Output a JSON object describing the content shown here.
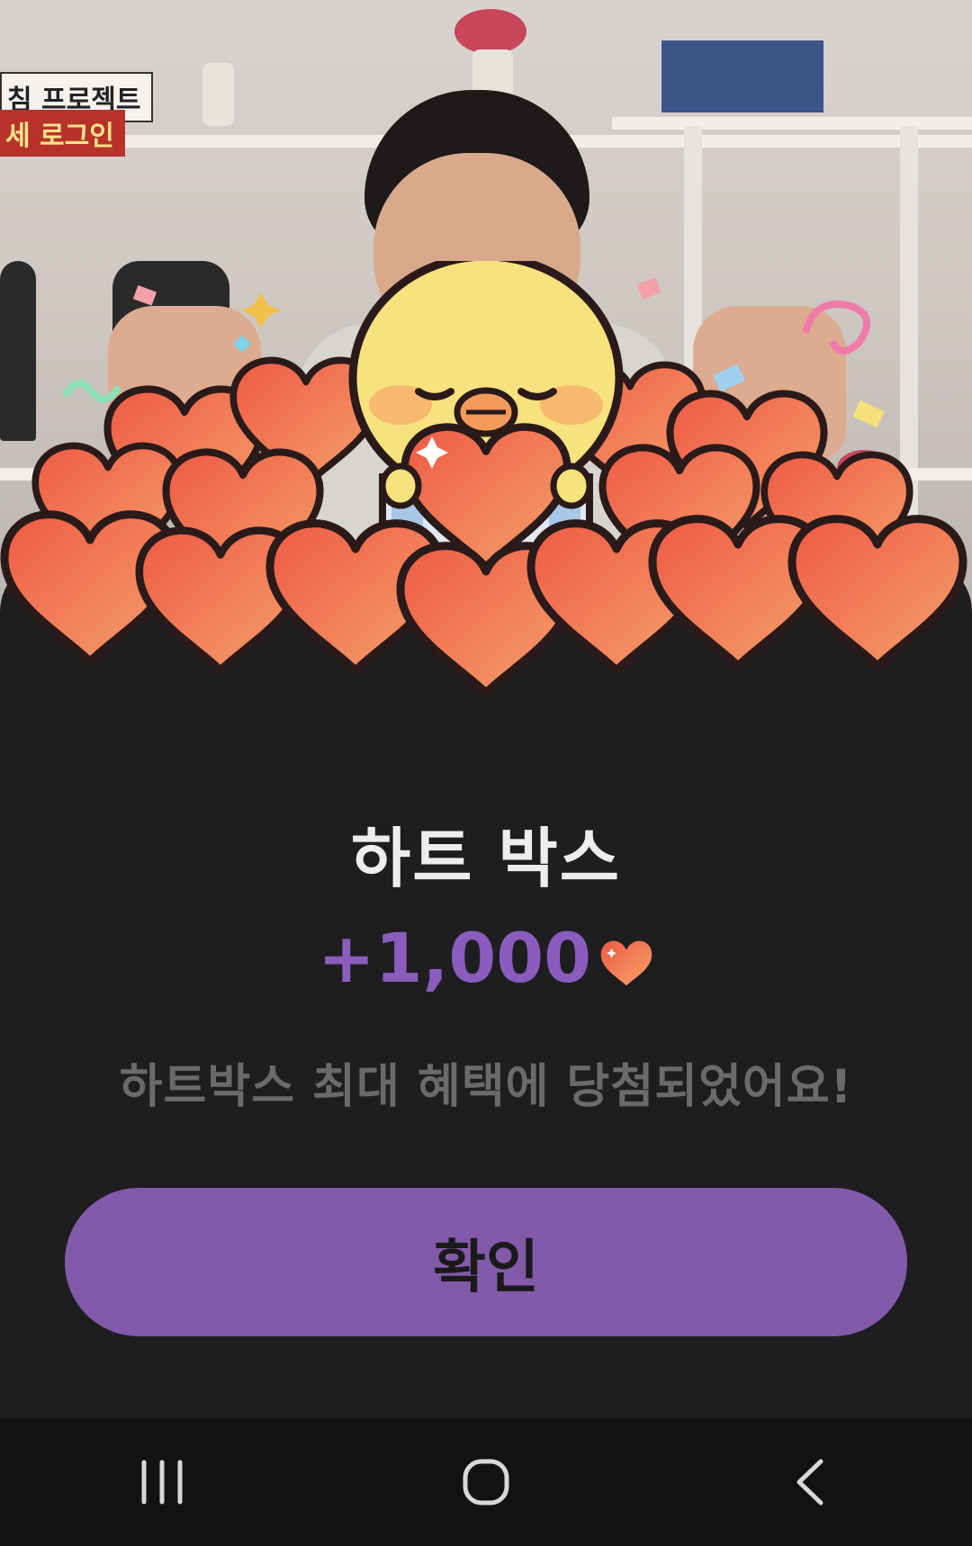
{
  "video": {
    "caption_top": "침 프로젝트",
    "caption_bottom": "세 로그인"
  },
  "dialog": {
    "title": "하트 박스",
    "reward_amount": "+1,000",
    "reward_icon": "heart-icon",
    "message": "하트박스 최대 혜택에 당첨되었어요!",
    "confirm_label": "확인"
  },
  "navbar": {
    "recent_icon": "recent-apps-icon",
    "home_icon": "home-icon",
    "back_icon": "back-icon"
  },
  "colors": {
    "accent": "#8359aa",
    "reward_text": "#8a5cbd",
    "panel_bg": "#1e1e20",
    "heart": "#f06a4a"
  }
}
